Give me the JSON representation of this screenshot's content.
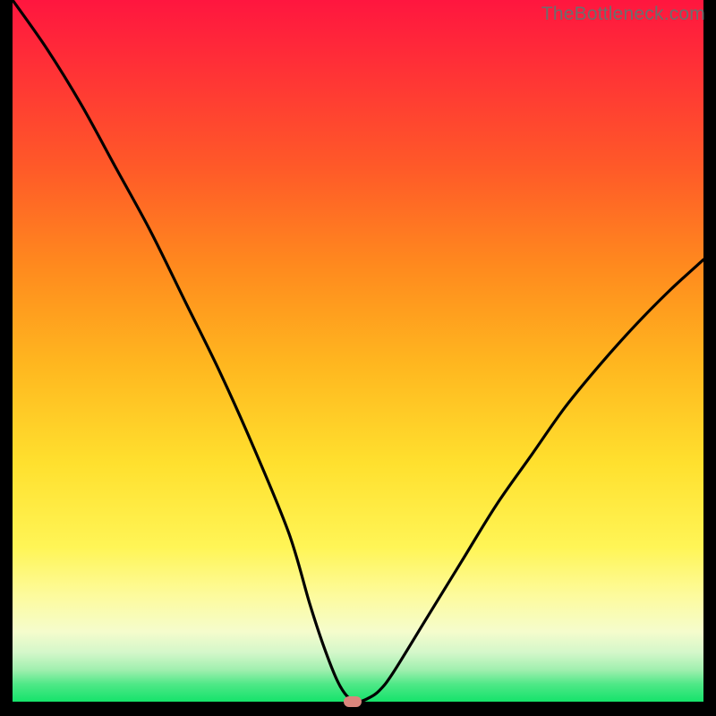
{
  "watermark": "TheBottleneck.com",
  "chart_data": {
    "type": "line",
    "title": "",
    "xlabel": "",
    "ylabel": "",
    "xlim": [
      0,
      100
    ],
    "ylim": [
      0,
      100
    ],
    "grid": false,
    "legend": false,
    "series": [
      {
        "name": "bottleneck-curve",
        "x": [
          0,
          5,
          10,
          15,
          20,
          25,
          30,
          35,
          40,
          43,
          45,
          47,
          48.5,
          50,
          51.5,
          53,
          55,
          60,
          65,
          70,
          75,
          80,
          85,
          90,
          95,
          100
        ],
        "y": [
          100,
          93,
          85,
          76,
          67,
          57,
          47,
          36,
          24,
          14,
          8,
          3,
          0.7,
          0,
          0.5,
          1.5,
          4,
          12,
          20,
          28,
          35,
          42,
          48,
          53.5,
          58.5,
          63
        ]
      }
    ],
    "marker": {
      "x": 49.2,
      "y": 0
    },
    "background_gradient": {
      "stops": [
        {
          "pos": 0,
          "color": "#ff163f"
        },
        {
          "pos": 0.66,
          "color": "#ffe02e"
        },
        {
          "pos": 0.9,
          "color": "#f5fccc"
        },
        {
          "pos": 1.0,
          "color": "#15e36b"
        }
      ]
    }
  }
}
